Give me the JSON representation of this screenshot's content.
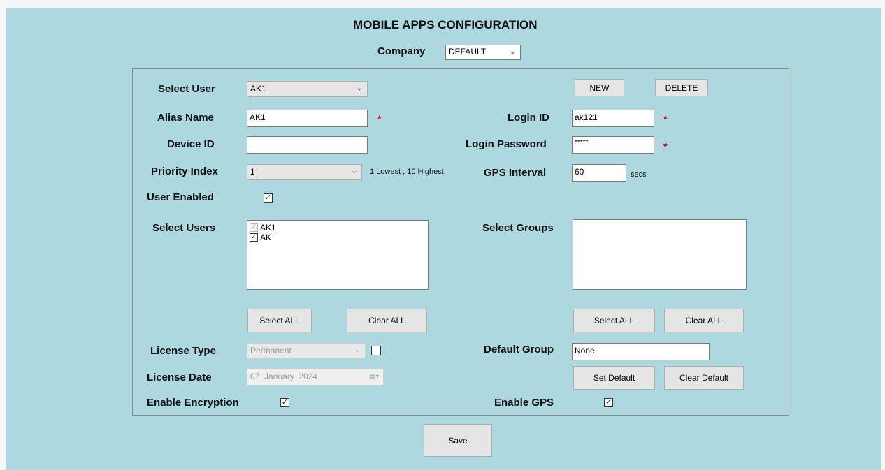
{
  "page": {
    "title": "MOBILE APPS CONFIGURATION"
  },
  "company": {
    "label": "Company",
    "value": "DEFAULT"
  },
  "user": {
    "select_user_label": "Select User",
    "select_user_value": "AK1",
    "new_label": "NEW",
    "delete_label": "DELETE",
    "alias_label": "Alias Name",
    "alias_value": "AK1",
    "login_id_label": "Login ID",
    "login_id_value": "ak121",
    "device_id_label": "Device ID",
    "device_id_value": "",
    "login_password_label": "Login Password",
    "login_password_value": "*****",
    "priority_label": "Priority Index",
    "priority_value": "1",
    "priority_hint": "1 Lowest ; 10 Highest",
    "gps_interval_label": "GPS Interval",
    "gps_interval_value": "60",
    "gps_interval_unit": "secs",
    "user_enabled_label": "User Enabled",
    "user_enabled_checked": true,
    "required_mark": "*"
  },
  "users_list": {
    "label": "Select Users",
    "items": [
      {
        "label": "AK1",
        "checked": true,
        "disabled": true
      },
      {
        "label": "AK",
        "checked": true,
        "disabled": false
      }
    ],
    "select_all_label": "Select ALL",
    "clear_all_label": "Clear ALL"
  },
  "groups_list": {
    "label": "Select Groups",
    "items": [],
    "select_all_label": "Select ALL",
    "clear_all_label": "Clear ALL"
  },
  "license": {
    "type_label": "License Type",
    "type_value": "Permanent",
    "type_checked": false,
    "date_label": "License Date",
    "date_day": "07",
    "date_month": "January",
    "date_year": "2024"
  },
  "default_group": {
    "label": "Default Group",
    "value": "None",
    "set_default_label": "Set Default",
    "clear_default_label": "Clear Default"
  },
  "encryption": {
    "label": "Enable Encryption",
    "checked": true
  },
  "gps": {
    "label": "Enable GPS",
    "checked": true
  },
  "save_label": "Save",
  "check_glyph": "✓"
}
